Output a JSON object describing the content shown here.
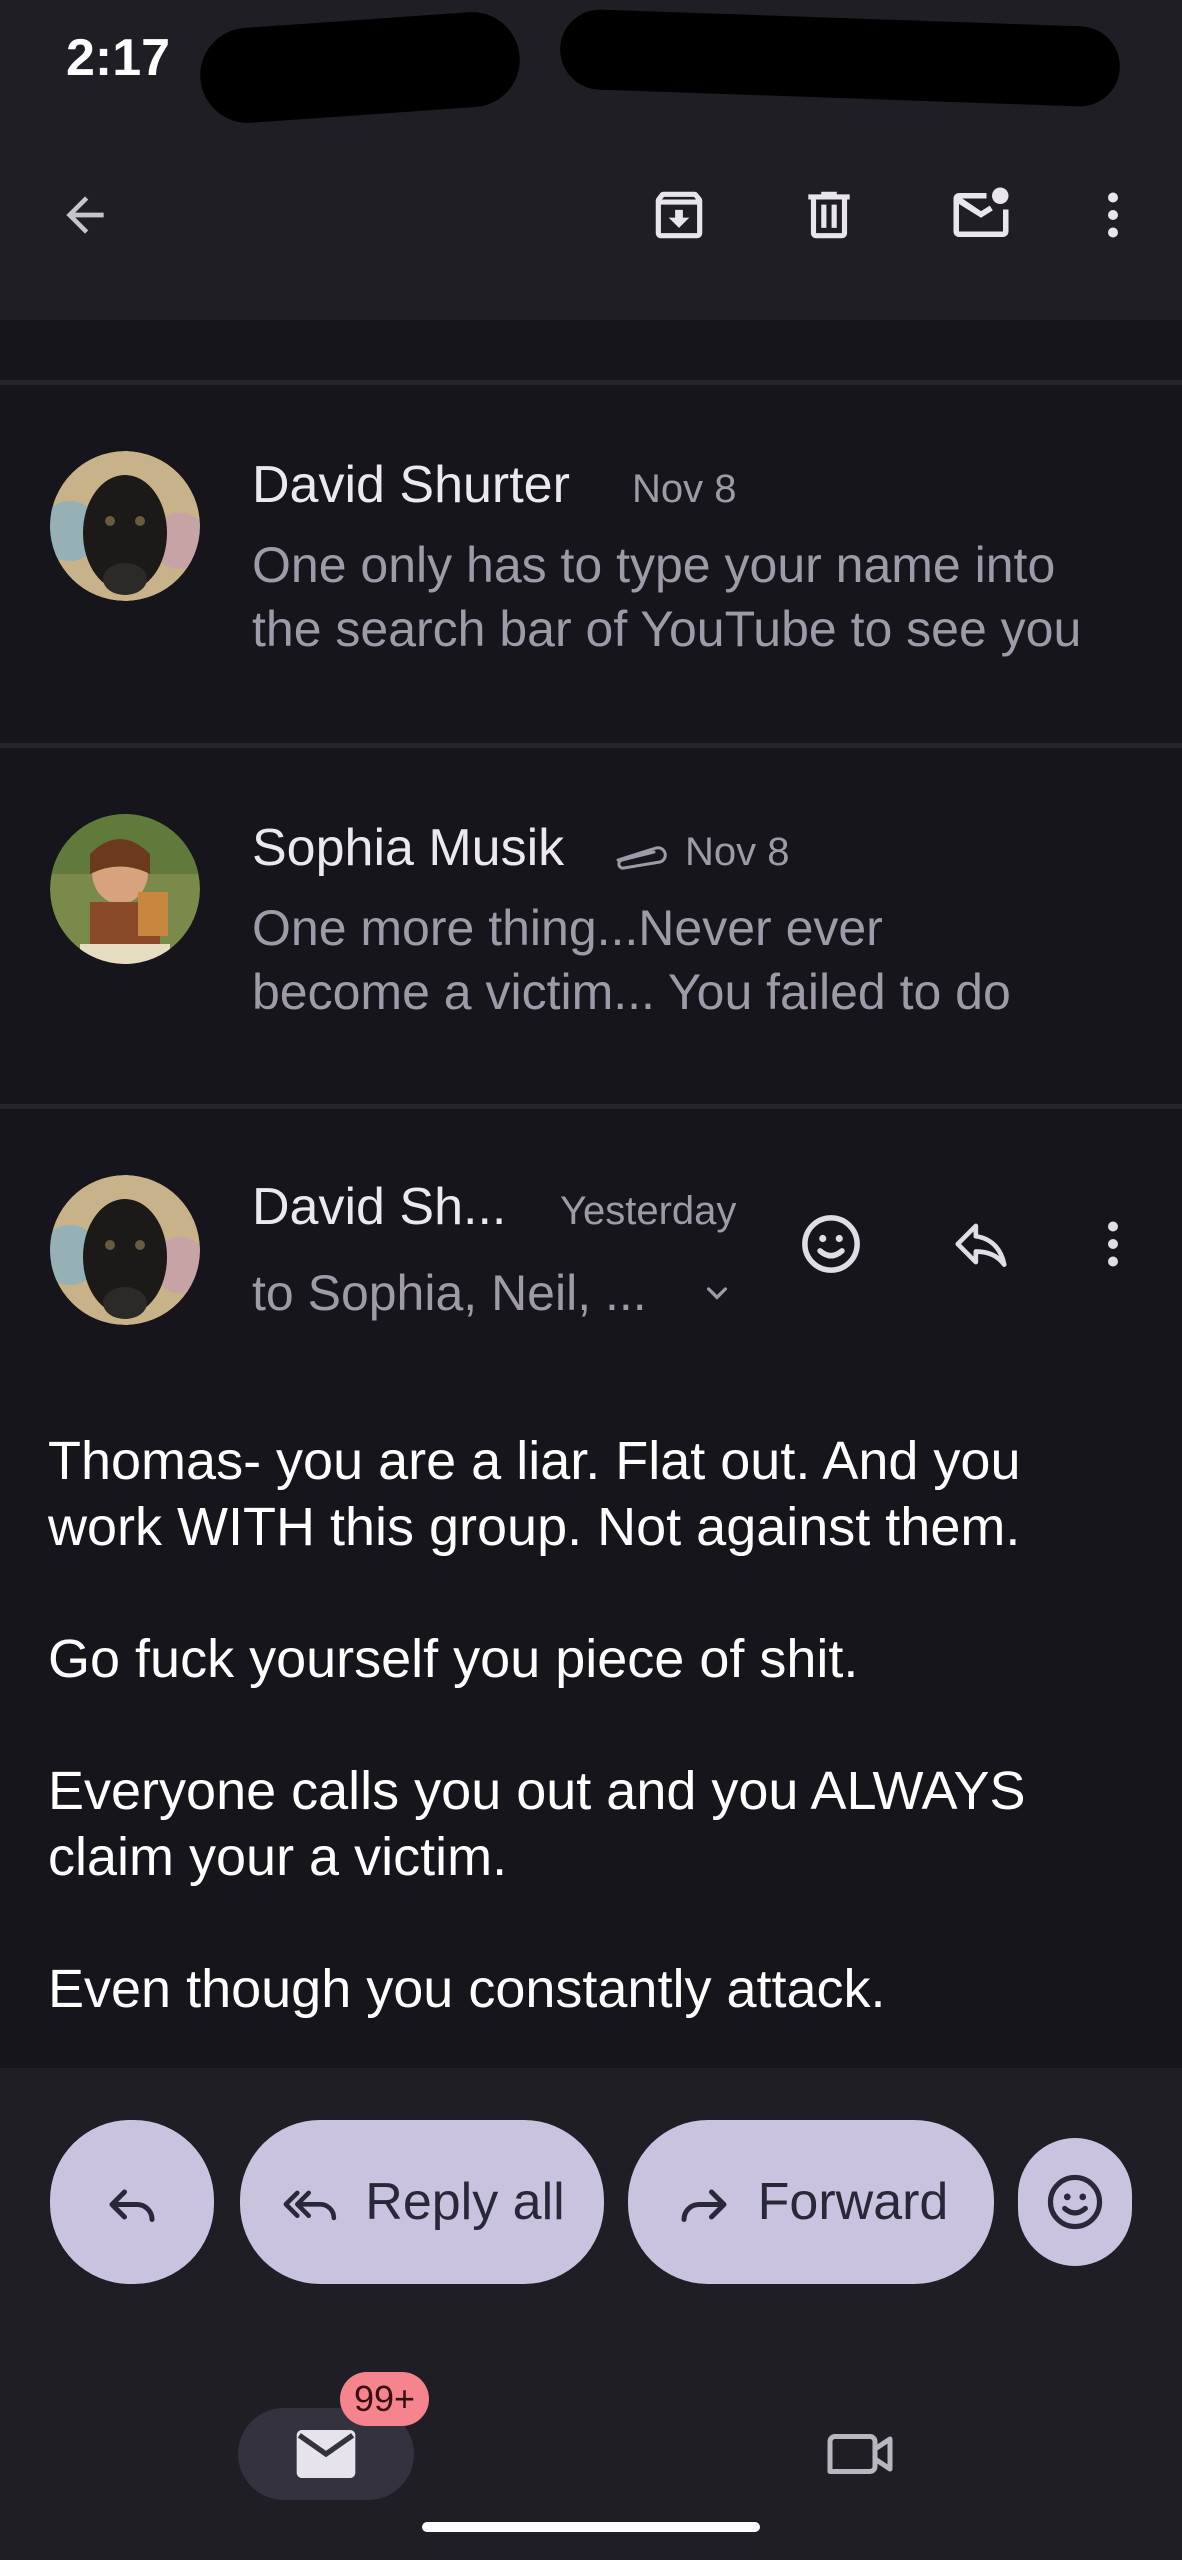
{
  "status_bar": {
    "time": "2:17"
  },
  "app_bar": {
    "icons": [
      "back-arrow-icon",
      "archive-icon",
      "delete-icon",
      "mark-unread-icon",
      "more-vert-icon"
    ]
  },
  "thread": {
    "collapsed": [
      {
        "sender": "David Shurter",
        "date": "Nov 8",
        "snippet_line1": "One only has to type your name into",
        "snippet_line2": "the search bar of YouTube to see you",
        "has_attachment": false
      },
      {
        "sender": "Sophia Musik",
        "date": "Nov 8",
        "snippet_line1": "One more thing...Never ever",
        "snippet_line2": "become a victim... You failed to do",
        "has_attachment": true
      }
    ],
    "expanded": {
      "sender": "David Sh...",
      "date": "Yesterday",
      "recipients": "to Sophia, Neil, ...",
      "body": [
        "Thomas- you are a liar. Flat out. And you work WITH this group. Not against them.",
        "Go fuck yourself you piece of shit.",
        "Everyone calls you out and you ALWAYS claim your a victim.",
        "Even though you constantly attack."
      ]
    }
  },
  "actions": {
    "reply_all": "Reply all",
    "forward": "Forward"
  },
  "bottom_nav": {
    "mail_badge": "99+"
  },
  "colors": {
    "background": "#16151b",
    "bar": "#1e1e24",
    "pill": "#c9c3e0",
    "badge": "#f5848f"
  }
}
